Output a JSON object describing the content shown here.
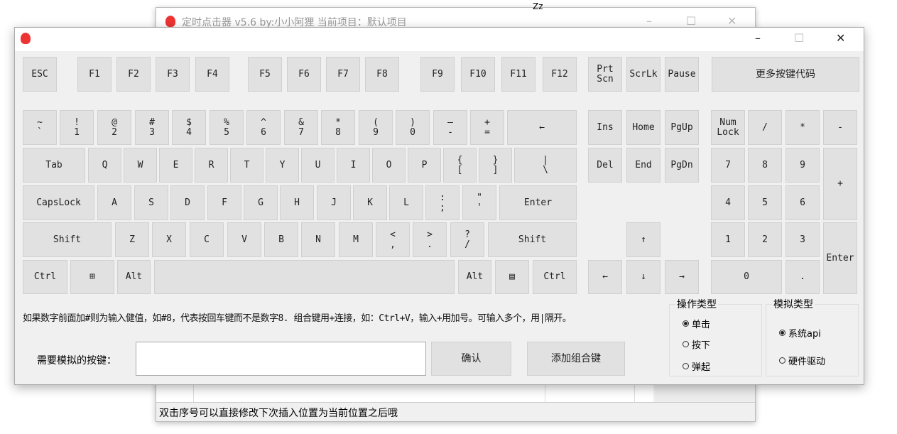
{
  "background_window": {
    "title": "定时点击器 v5.6  by:小小阿狸  当前项目：默认项目",
    "status": "双击序号可以直接修改下次插入位置为当前位置之后哦"
  },
  "top_glyph": "Zz",
  "window_controls": {
    "minimize": "–",
    "maximize": "☐",
    "close": "✕"
  },
  "keys": {
    "function_row": [
      "ESC",
      "F1",
      "F2",
      "F3",
      "F4",
      "F5",
      "F6",
      "F7",
      "F8",
      "F9",
      "F10",
      "F11",
      "F12",
      "Prt\nScn",
      "ScrLk",
      "Pause",
      "更多按键代码"
    ],
    "number_row": [
      "~\n`",
      "!\n1",
      "@\n2",
      "#\n3",
      "$\n4",
      "%\n5",
      "^\n6",
      "&\n7",
      "*\n8",
      "(\n9",
      ")\n0",
      "—\n-",
      "+\n=",
      "←",
      "Ins",
      "Home",
      "PgUp",
      "Num\nLock",
      "/",
      "*",
      "-"
    ],
    "qwerty_row": [
      "Tab",
      "Q",
      "W",
      "E",
      "R",
      "T",
      "Y",
      "U",
      "I",
      "O",
      "P",
      "{\n[",
      "}\n]",
      "|\n\\",
      "Del",
      "End",
      "PgDn",
      "7",
      "8",
      "9",
      "+"
    ],
    "home_row": [
      "CapsLock",
      "A",
      "S",
      "D",
      "F",
      "G",
      "H",
      "J",
      "K",
      "L",
      ":\n;",
      "\"\n'",
      "Enter",
      "4",
      "5",
      "6"
    ],
    "shift_row": [
      "Shift",
      "Z",
      "X",
      "C",
      "V",
      "B",
      "N",
      "M",
      "<\n,",
      ">\n.",
      "?\n/",
      "Shift",
      "↑",
      "1",
      "2",
      "3",
      "Enter"
    ],
    "bottom_row": [
      "Ctrl",
      "⊞",
      "Alt",
      "",
      "Alt",
      "▤",
      "Ctrl",
      "←",
      "↓",
      "→",
      "0",
      "."
    ]
  },
  "hint": "如果数字前面加#则为输入健值，如#8，代表按回车键而不是数字8. 组合键用+连接，如：Ctrl+V，输入+用加号。可输入多个，用|隔开。",
  "input_label": "需要模拟的按键：",
  "input_value": "",
  "confirm_button": "确认",
  "add_combo_button": "添加组合键",
  "operation_type": {
    "label": "操作类型",
    "options": [
      "单击",
      "按下",
      "弹起"
    ],
    "selected": 0
  },
  "simulation_type": {
    "label": "模拟类型",
    "options": [
      "系统api",
      "硬件驱动"
    ],
    "selected": 0
  }
}
